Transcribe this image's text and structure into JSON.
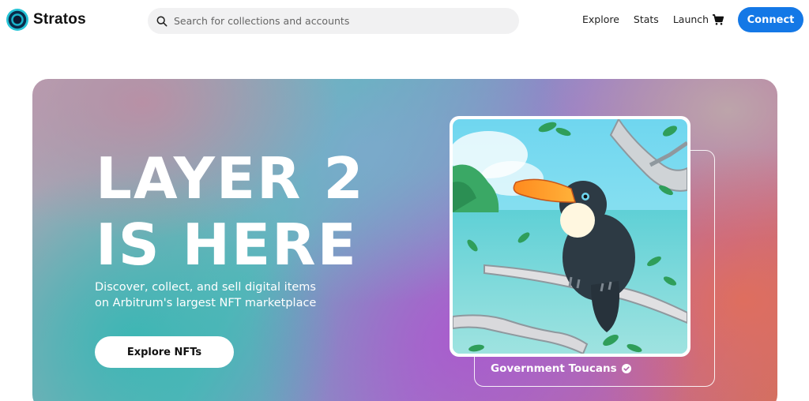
{
  "brand": {
    "name": "Stratos"
  },
  "search": {
    "placeholder": "Search for collections and accounts"
  },
  "nav": {
    "items": [
      "Explore",
      "Stats",
      "Launch"
    ]
  },
  "header": {
    "connect_label": "Connect"
  },
  "hero": {
    "title_line1": "LAYER 2",
    "title_line2": "IS HERE",
    "subtitle_line1": "Discover, collect, and sell digital items",
    "subtitle_line2": "on Arbitrum's largest NFT marketplace",
    "cta_label": "Explore NFTs",
    "featured": {
      "collection_name": "Government Toucans",
      "verified": true
    }
  },
  "colors": {
    "primary": "#1478e6",
    "text": "#111111",
    "hero_text": "#ffffff"
  }
}
